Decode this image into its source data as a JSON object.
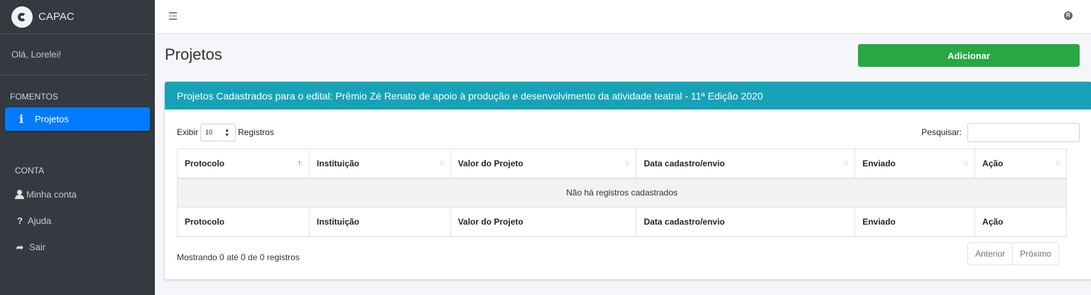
{
  "brand": {
    "name": "CAPAC"
  },
  "user": {
    "greeting": "Olá, Lorelei!"
  },
  "sidebar": {
    "sections": [
      {
        "header": "FOMENTOS",
        "items": [
          {
            "label": "Projetos",
            "icon": "info-icon",
            "active": true
          }
        ]
      },
      {
        "header": "CONTA",
        "items": [
          {
            "label": "Minha conta",
            "icon": "user-icon"
          },
          {
            "label": "Ajuda",
            "icon": "question-icon"
          },
          {
            "label": "Sair",
            "icon": "sign-out-icon"
          }
        ]
      }
    ]
  },
  "topbar": {
    "menu_icon": "hamburger-icon",
    "right_icon": "R"
  },
  "page": {
    "title": "Projetos",
    "add_label": "Adicionar"
  },
  "card": {
    "title": "Projetos Cadastrados para o edital: Prêmio Zé Renato de apoio à produção e desenvolvimento da atividade teatral - 11ª Edição 2020"
  },
  "table_controls": {
    "show_label": "Exibir",
    "show_value": "10",
    "records_label": "Registros",
    "search_label": "Pesquisar:",
    "search_value": ""
  },
  "table": {
    "columns": [
      "Protocolo",
      "Instituição",
      "Valor do Projeto",
      "Data cadastro/envio",
      "Enviado",
      "Ação"
    ],
    "empty_message": "Não há registros cadastrados"
  },
  "footer": {
    "info": "Mostrando 0 até 0 de 0 registros",
    "prev_label": "Anterior",
    "next_label": "Próximo"
  },
  "colors": {
    "sidebar_bg": "#343a40",
    "active": "#007bff",
    "header_bg": "#17a2b8",
    "add_btn": "#28a745"
  }
}
